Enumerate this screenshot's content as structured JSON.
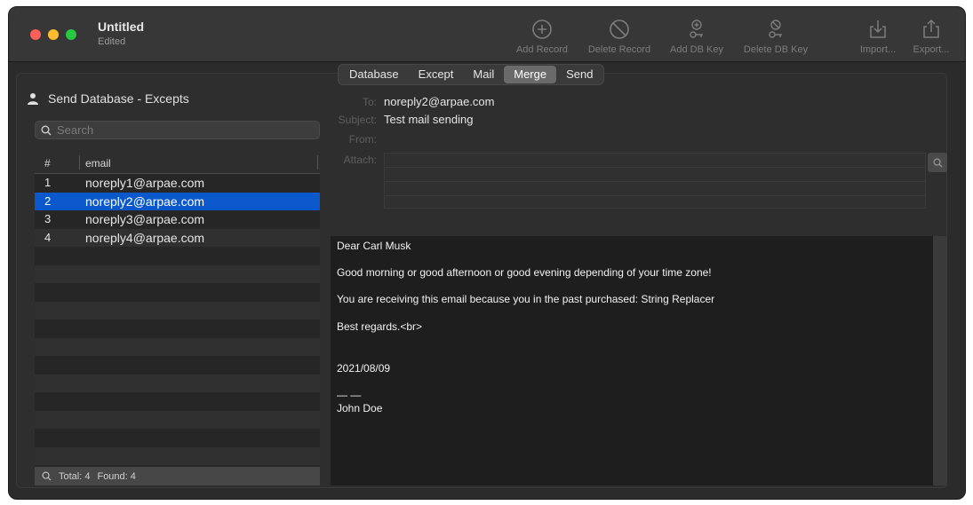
{
  "window": {
    "title": "Untitled",
    "subtitle": "Edited"
  },
  "toolbar": {
    "add_record": "Add Record",
    "delete_record": "Delete Record",
    "add_db_key": "Add DB Key",
    "delete_db_key": "Delete DB Key",
    "import": "Import...",
    "export": "Export..."
  },
  "tabs": [
    "Database",
    "Except",
    "Mail",
    "Merge",
    "Send"
  ],
  "active_tab": "Merge",
  "sidebar": {
    "title": "Send Database - Excepts",
    "search_placeholder": "Search",
    "col_num": "#",
    "col_email": "email",
    "rows": [
      {
        "num": "1",
        "email": "noreply1@arpae.com"
      },
      {
        "num": "2",
        "email": "noreply2@arpae.com"
      },
      {
        "num": "3",
        "email": "noreply3@arpae.com"
      },
      {
        "num": "4",
        "email": "noreply4@arpae.com"
      }
    ],
    "selected_row": "2",
    "status_total": "Total: 4",
    "status_found": "Found: 4"
  },
  "mail": {
    "to_label": "To:",
    "to_value": "noreply2@arpae.com",
    "subject_label": "Subject:",
    "subject_value": "Test mail sending",
    "from_label": "From:",
    "attach_label": "Attach:"
  },
  "body_lines": {
    "l1": "Dear Carl Musk",
    "l2": "Good morning or good afternoon or good evening depending of your time zone!",
    "l3": "You are receiving this email because you in the past purchased: String Replacer",
    "l4": "Best regards.<br>",
    "l5": "2021/08/09",
    "l6": "— —",
    "l7": "John Doe"
  },
  "colors": {
    "selection": "#0b58cc",
    "window_bg": "#2b2b2b"
  }
}
